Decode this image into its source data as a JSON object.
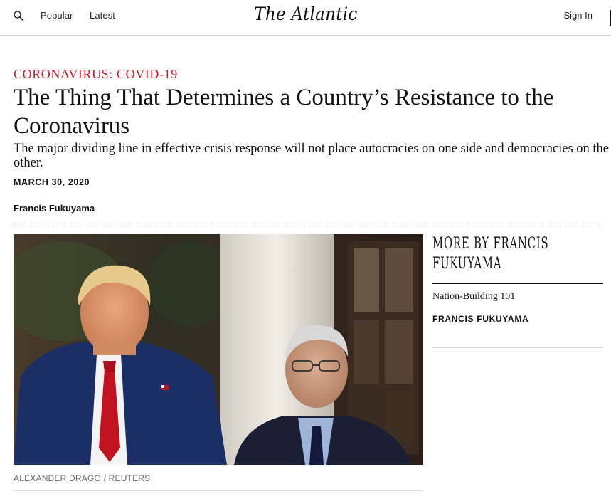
{
  "header": {
    "search_icon": "search-icon",
    "nav": [
      {
        "label": "Popular"
      },
      {
        "label": "Latest"
      }
    ],
    "logo": "The Atlantic",
    "sign_in": "Sign In"
  },
  "article": {
    "kicker": "CORONAVIRUS: COVID-19",
    "headline": "The Thing That Determines a Country’s Resistance to the Coronavirus",
    "dek": "The major dividing line in effective crisis response will not place autocracies on one side and democracies on the other.",
    "date": "MARCH 30, 2020",
    "author": "Francis Fukuyama",
    "image_credit": "ALEXANDER DRAGO / REUTERS"
  },
  "sidebar": {
    "heading": "More by Francis Fukuyama",
    "items": [
      {
        "title": "Nation-Building 101",
        "author": "FRANCIS FUKUYAMA"
      }
    ]
  },
  "colors": {
    "kicker": "#d01d2a",
    "text": "#111111",
    "credit": "#6b6b6b"
  }
}
